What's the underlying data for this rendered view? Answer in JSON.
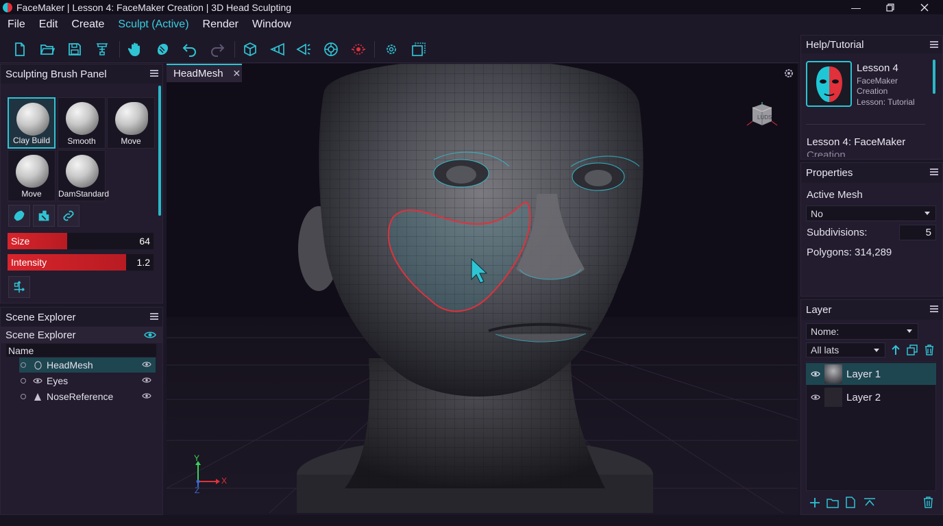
{
  "window": {
    "title": "FaceMaker | Lesson 4: FaceMaker Creation | 3D Head Sculpting",
    "controls": [
      "minimize-icon",
      "restore-icon",
      "close-icon"
    ]
  },
  "menu": {
    "items": [
      {
        "label": "File"
      },
      {
        "label": "Edit"
      },
      {
        "label": "Create"
      },
      {
        "label": "Sculpt (Active)"
      },
      {
        "label": "Render"
      },
      {
        "label": "Window"
      }
    ]
  },
  "toolbar": {
    "icons": [
      "new-file-icon",
      "open-folder-icon",
      "save-icon",
      "symmetry-icon",
      "hand-icon",
      "sculpt-icon",
      "undo-icon",
      "redo-icon",
      "cube-icon",
      "perspective-icon",
      "camera-icon",
      "target-icon",
      "record-icon",
      "settings-gear-icon",
      "frame-icon"
    ]
  },
  "colors": {
    "accent": "#2fc4d4",
    "active_red": "#d8242c",
    "background": "#1c1727"
  },
  "brush_panel": {
    "title": "Sculpting Brush Panel",
    "brushes": [
      {
        "label": "Clay Build",
        "selected": true
      },
      {
        "label": "Smooth"
      },
      {
        "label": "Move"
      },
      {
        "label": "Move"
      },
      {
        "label": "DamStandard"
      }
    ],
    "size": {
      "label": "Size",
      "value": "64",
      "fraction": 0.41
    },
    "intensity": {
      "label": "Intensity",
      "value": "1.2",
      "fraction": 0.81
    }
  },
  "scene_explorer": {
    "panel_title": "Scene Explorer",
    "section_title": "Scene Explorer",
    "column_header": "Name",
    "items": [
      {
        "name": "HeadMesh",
        "icon": "mesh-icon",
        "selected": true
      },
      {
        "name": "Eyes",
        "icon": "eye-object-icon"
      },
      {
        "name": "NoseReference",
        "icon": "cone-icon"
      }
    ]
  },
  "viewport": {
    "tab_label": "HeadMesh",
    "gizmo_cube_label": "LUDS",
    "axis": {
      "x": "X",
      "y": "Y",
      "z": "Z"
    }
  },
  "help": {
    "title": "Help/Tutorial",
    "card_title": "Lesson 4",
    "card_line1": "FaceMaker",
    "card_line2": "Creation",
    "card_line3": "Lesson: Tutorial",
    "lesson_text": "Lesson 4: FaceMaker",
    "lesson_text_cut": "Creation"
  },
  "properties": {
    "title": "Properties",
    "active_mesh_label": "Active Mesh",
    "active_mesh_value": "No",
    "subdivisions_label": "Subdivisions:",
    "subdivisions_value": "5",
    "polygons": "Polygons: 314,289"
  },
  "layer": {
    "title": "Layer",
    "name_select": "Nome:",
    "filter_select": "All lats",
    "rows": [
      {
        "label": "Layer 1",
        "selected": true
      },
      {
        "label": "Layer 2"
      }
    ]
  }
}
